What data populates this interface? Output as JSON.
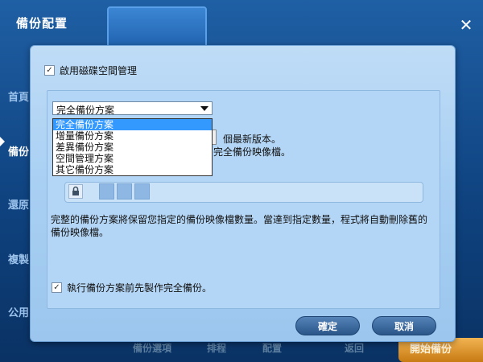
{
  "app": {
    "title": "備份配置",
    "sidebar": [
      "首頁",
      "備份",
      "還原",
      "複製",
      "公用"
    ],
    "bottom": [
      "備份選項",
      "排程",
      "配置",
      "返回",
      "開始備份"
    ]
  },
  "dialog": {
    "enable_disk_mgmt": {
      "label": "啟用磁碟空間管理",
      "checked": true
    },
    "scheme_select": {
      "value": "完全備份方案",
      "options": [
        "完全備份方案",
        "增量備份方案",
        "差異備份方案",
        "空間管理方案",
        "其它備份方案"
      ],
      "selected_index": 0
    },
    "partial_text_1": "個最新版本。",
    "partial_text_2": "完全備份映像檔。",
    "description": "完整的備份方案將保留您指定的備份映像檔數量。當達到指定數量，程式將自動刪除舊的備份映像檔。",
    "pre_full_backup": {
      "label": "執行備份方案前先製作完全備份。",
      "checked": true
    },
    "buttons": {
      "ok": "確定",
      "cancel": "取消"
    }
  },
  "icons": {
    "check": "checkmark-icon",
    "lock": "lock-icon",
    "close": "close-icon"
  }
}
